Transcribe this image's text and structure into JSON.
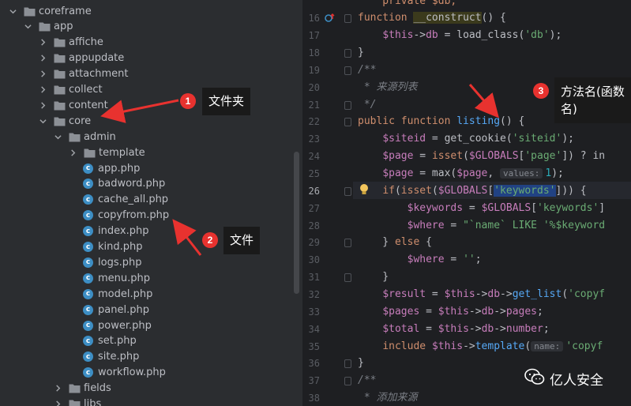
{
  "project_tree": [
    {
      "label": "coreframe",
      "type": "folder",
      "depth": 0,
      "expanded": true
    },
    {
      "label": "app",
      "type": "folder",
      "depth": 1,
      "expanded": true
    },
    {
      "label": "affiche",
      "type": "folder",
      "depth": 2,
      "expanded": false
    },
    {
      "label": "appupdate",
      "type": "folder",
      "depth": 2,
      "expanded": false
    },
    {
      "label": "attachment",
      "type": "folder",
      "depth": 2,
      "expanded": false
    },
    {
      "label": "collect",
      "type": "folder",
      "depth": 2,
      "expanded": false
    },
    {
      "label": "content",
      "type": "folder",
      "depth": 2,
      "expanded": false
    },
    {
      "label": "core",
      "type": "folder",
      "depth": 2,
      "expanded": true
    },
    {
      "label": "admin",
      "type": "folder",
      "depth": 3,
      "expanded": true
    },
    {
      "label": "template",
      "type": "folder",
      "depth": 4,
      "expanded": false
    },
    {
      "label": "app.php",
      "type": "php",
      "depth": 4
    },
    {
      "label": "badword.php",
      "type": "php",
      "depth": 4
    },
    {
      "label": "cache_all.php",
      "type": "php",
      "depth": 4
    },
    {
      "label": "copyfrom.php",
      "type": "php",
      "depth": 4
    },
    {
      "label": "index.php",
      "type": "php",
      "depth": 4
    },
    {
      "label": "kind.php",
      "type": "php",
      "depth": 4
    },
    {
      "label": "logs.php",
      "type": "php",
      "depth": 4
    },
    {
      "label": "menu.php",
      "type": "php",
      "depth": 4
    },
    {
      "label": "model.php",
      "type": "php",
      "depth": 4
    },
    {
      "label": "panel.php",
      "type": "php",
      "depth": 4
    },
    {
      "label": "power.php",
      "type": "php",
      "depth": 4
    },
    {
      "label": "set.php",
      "type": "php",
      "depth": 4
    },
    {
      "label": "site.php",
      "type": "php",
      "depth": 4
    },
    {
      "label": "workflow.php",
      "type": "php",
      "depth": 4
    },
    {
      "label": "fields",
      "type": "folder",
      "depth": 3,
      "expanded": false
    },
    {
      "label": "libs",
      "type": "folder",
      "depth": 3,
      "expanded": false
    }
  ],
  "editor": {
    "current_line": "26",
    "lines": [
      {
        "n": "",
        "tokens": [
          {
            "t": "    private $db;",
            "c": "kw"
          }
        ]
      },
      {
        "n": "16",
        "tokens": [
          {
            "t": "function ",
            "c": "kw"
          },
          {
            "t": "__construct",
            "c": "fnbg"
          },
          {
            "t": "() {",
            "c": ""
          }
        ]
      },
      {
        "n": "17",
        "tokens": [
          {
            "t": "    ",
            "c": ""
          },
          {
            "t": "$this",
            "c": "var"
          },
          {
            "t": "->",
            "c": ""
          },
          {
            "t": "db",
            "c": "var"
          },
          {
            "t": " = load_class(",
            "c": ""
          },
          {
            "t": "'db'",
            "c": "str"
          },
          {
            "t": ");",
            "c": ""
          }
        ]
      },
      {
        "n": "18",
        "tokens": [
          {
            "t": "}",
            "c": ""
          }
        ]
      },
      {
        "n": "19",
        "tokens": [
          {
            "t": "/**",
            "c": "cmt"
          }
        ]
      },
      {
        "n": "20",
        "tokens": [
          {
            "t": " * 来源列表",
            "c": "cmt"
          }
        ]
      },
      {
        "n": "21",
        "tokens": [
          {
            "t": " */",
            "c": "cmt"
          }
        ]
      },
      {
        "n": "22",
        "tokens": [
          {
            "t": "public function ",
            "c": "kw"
          },
          {
            "t": "listing",
            "c": "fn"
          },
          {
            "t": "() {",
            "c": ""
          }
        ]
      },
      {
        "n": "23",
        "tokens": [
          {
            "t": "    ",
            "c": ""
          },
          {
            "t": "$siteid",
            "c": "var"
          },
          {
            "t": " = get_cookie(",
            "c": ""
          },
          {
            "t": "'siteid'",
            "c": "str"
          },
          {
            "t": ");",
            "c": ""
          }
        ]
      },
      {
        "n": "24",
        "tokens": [
          {
            "t": "    ",
            "c": ""
          },
          {
            "t": "$page",
            "c": "var"
          },
          {
            "t": " = ",
            "c": ""
          },
          {
            "t": "isset",
            "c": "kw"
          },
          {
            "t": "(",
            "c": ""
          },
          {
            "t": "$GLOBALS",
            "c": "var"
          },
          {
            "t": "[",
            "c": ""
          },
          {
            "t": "'page'",
            "c": "str"
          },
          {
            "t": "]) ? in",
            "c": ""
          }
        ]
      },
      {
        "n": "25",
        "tokens": [
          {
            "t": "    ",
            "c": ""
          },
          {
            "t": "$page",
            "c": "var"
          },
          {
            "t": " = max(",
            "c": ""
          },
          {
            "t": "$page",
            "c": "var"
          },
          {
            "t": ", ",
            "c": ""
          },
          {
            "t": "values:",
            "c": "hint"
          },
          {
            "t": "1",
            "c": "num"
          },
          {
            "t": ");",
            "c": ""
          }
        ]
      },
      {
        "n": "26",
        "tokens": [
          {
            "t": "    ",
            "c": ""
          },
          {
            "t": "if",
            "c": "kw"
          },
          {
            "t": "(",
            "c": ""
          },
          {
            "t": "isset",
            "c": "kw"
          },
          {
            "t": "(",
            "c": ""
          },
          {
            "t": "$GLOBALS",
            "c": "var"
          },
          {
            "t": "[",
            "c": ""
          },
          {
            "t": "'keywords'",
            "c": "str hl"
          },
          {
            "t": "])) {",
            "c": ""
          }
        ]
      },
      {
        "n": "27",
        "tokens": [
          {
            "t": "        ",
            "c": ""
          },
          {
            "t": "$keywords",
            "c": "var"
          },
          {
            "t": " = ",
            "c": ""
          },
          {
            "t": "$GLOBALS",
            "c": "var"
          },
          {
            "t": "[",
            "c": ""
          },
          {
            "t": "'keywords'",
            "c": "str"
          },
          {
            "t": "]",
            "c": ""
          }
        ]
      },
      {
        "n": "28",
        "tokens": [
          {
            "t": "        ",
            "c": ""
          },
          {
            "t": "$where",
            "c": "var"
          },
          {
            "t": " = ",
            "c": ""
          },
          {
            "t": "\"`name` LIKE '%$keyword",
            "c": "str"
          }
        ]
      },
      {
        "n": "29",
        "tokens": [
          {
            "t": "    } ",
            "c": ""
          },
          {
            "t": "else",
            "c": "kw"
          },
          {
            "t": " {",
            "c": ""
          }
        ]
      },
      {
        "n": "30",
        "tokens": [
          {
            "t": "        ",
            "c": ""
          },
          {
            "t": "$where",
            "c": "var"
          },
          {
            "t": " = ",
            "c": ""
          },
          {
            "t": "''",
            "c": "str"
          },
          {
            "t": ";",
            "c": ""
          }
        ]
      },
      {
        "n": "31",
        "tokens": [
          {
            "t": "    }",
            "c": ""
          }
        ]
      },
      {
        "n": "32",
        "tokens": [
          {
            "t": "    ",
            "c": ""
          },
          {
            "t": "$result",
            "c": "var"
          },
          {
            "t": " = ",
            "c": ""
          },
          {
            "t": "$this",
            "c": "var"
          },
          {
            "t": "->",
            "c": ""
          },
          {
            "t": "db",
            "c": "var"
          },
          {
            "t": "->",
            "c": ""
          },
          {
            "t": "get_list",
            "c": "fn"
          },
          {
            "t": "(",
            "c": ""
          },
          {
            "t": "'copyf",
            "c": "str"
          }
        ]
      },
      {
        "n": "33",
        "tokens": [
          {
            "t": "    ",
            "c": ""
          },
          {
            "t": "$pages",
            "c": "var"
          },
          {
            "t": " = ",
            "c": ""
          },
          {
            "t": "$this",
            "c": "var"
          },
          {
            "t": "->",
            "c": ""
          },
          {
            "t": "db",
            "c": "var"
          },
          {
            "t": "->",
            "c": ""
          },
          {
            "t": "pages",
            "c": "var"
          },
          {
            "t": ";",
            "c": ""
          }
        ]
      },
      {
        "n": "34",
        "tokens": [
          {
            "t": "    ",
            "c": ""
          },
          {
            "t": "$total",
            "c": "var"
          },
          {
            "t": " = ",
            "c": ""
          },
          {
            "t": "$this",
            "c": "var"
          },
          {
            "t": "->",
            "c": ""
          },
          {
            "t": "db",
            "c": "var"
          },
          {
            "t": "->",
            "c": ""
          },
          {
            "t": "number",
            "c": "var"
          },
          {
            "t": ";",
            "c": ""
          }
        ]
      },
      {
        "n": "35",
        "tokens": [
          {
            "t": "    ",
            "c": ""
          },
          {
            "t": "include ",
            "c": "kw"
          },
          {
            "t": "$this",
            "c": "var"
          },
          {
            "t": "->",
            "c": ""
          },
          {
            "t": "template",
            "c": "fn"
          },
          {
            "t": "(",
            "c": ""
          },
          {
            "t": "name:",
            "c": "hint"
          },
          {
            "t": "'copyf",
            "c": "str"
          }
        ]
      },
      {
        "n": "36",
        "tokens": [
          {
            "t": "}",
            "c": ""
          }
        ]
      },
      {
        "n": "37",
        "tokens": [
          {
            "t": "/**",
            "c": "cmt"
          }
        ]
      },
      {
        "n": "38",
        "tokens": [
          {
            "t": " * 添加来源",
            "c": "cmt"
          }
        ]
      }
    ]
  },
  "annotations": [
    {
      "number": "1",
      "label": "文件夹"
    },
    {
      "number": "2",
      "label": "文件"
    },
    {
      "number": "3",
      "label": "方法名(函数名)"
    }
  ],
  "watermark": {
    "text": "亿人安全",
    "icon": "wechat-icon"
  },
  "colors": {
    "folder": "#8c9096",
    "php_badge": "#3d8ec4",
    "annotation": "#e8322f"
  }
}
